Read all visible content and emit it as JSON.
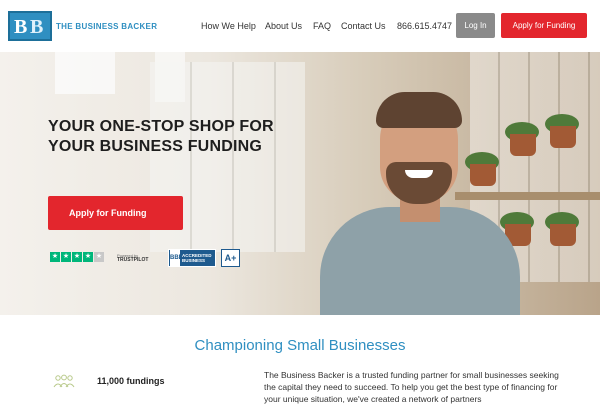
{
  "header": {
    "logo_text": "THE BUSINESS BACKER",
    "logo_mark": "BB",
    "nav": [
      {
        "label": "How We Help"
      },
      {
        "label": "About Us"
      },
      {
        "label": "FAQ"
      },
      {
        "label": "Contact Us"
      }
    ],
    "phone": "866.615.4747",
    "login_label": "Log In",
    "apply_label": "Apply for Funding"
  },
  "hero": {
    "title": "YOUR ONE-STOP SHOP FOR YOUR BUSINESS FUNDING",
    "cta_label": "Apply for Funding",
    "trustpilot_powered": "Powered by",
    "trustpilot_brand": "TRUSTPILOT",
    "bbb_logo": "BBB",
    "bbb_text": "ACCREDITED BUSINESS",
    "bbb_rating": "A+"
  },
  "section": {
    "title": "Championing Small Businesses",
    "stat_label": "11,000 fundings",
    "body": "The Business Backer is a trusted funding partner for small businesses seeking the capital they need to succeed. To help you get the best type of financing for your unique situation, we've created a network of partners"
  },
  "colors": {
    "brand_blue": "#2f8fc1",
    "cta_red": "#e3262d",
    "login_grey": "#8a8a8a",
    "trustpilot_green": "#00b67a"
  },
  "icons": {
    "stat": "group-of-people-icon",
    "star": "star-icon"
  }
}
